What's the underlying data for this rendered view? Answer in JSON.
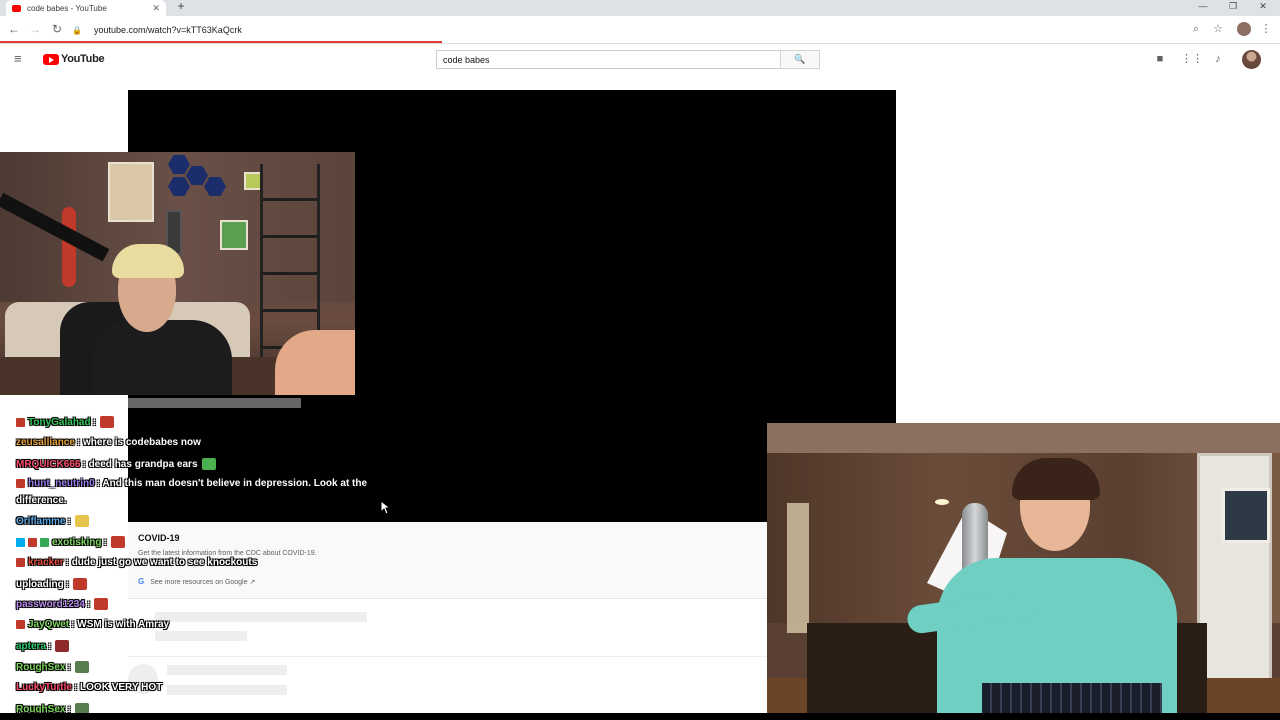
{
  "browser": {
    "tab_title": "code babes - YouTube",
    "tab_close": "✕",
    "new_tab": "+",
    "url": "youtube.com/watch?v=kTT63KaQcrk",
    "window_controls": [
      "—",
      "❐",
      "✕"
    ]
  },
  "youtube": {
    "logo_text": "YouTube",
    "search_value": "code babes",
    "search_button": "🔍"
  },
  "chat": {
    "messages": [
      {
        "user": "TonyGalahad",
        "user_color": "#34c759",
        "message": ":",
        "badges": [
          "red"
        ],
        "emote_color": "#c0392b"
      },
      {
        "user": "zeusalliance",
        "user_color": "#e8a33d",
        "message": ": where is codebabes now",
        "badges": [],
        "emote_color": ""
      },
      {
        "user": "MRQUICK666",
        "user_color": "#ff4d6d",
        "message": ": deed has grandpa ears",
        "badges": [],
        "emote_color": "#4caf50"
      },
      {
        "user": "hunt_neutrin0",
        "user_color": "#9c7df0",
        "message": ": And this man doesn't believe in depression. Look at the",
        "badges": [
          "red"
        ],
        "emote_color": ""
      },
      {
        "user": "",
        "user_color": "#ffffff",
        "message": "difference.",
        "badges": [],
        "emote_color": ""
      },
      {
        "user": "Oriflamme",
        "user_color": "#5aa8e6",
        "message": ":",
        "badges": [],
        "emote_color": "#e6c34a"
      },
      {
        "user": "exotisking",
        "user_color": "#7bd65a",
        "message": ":",
        "badges": [
          "blue",
          "red",
          "green"
        ],
        "emote_color": "#c0392b"
      },
      {
        "user": "kracker",
        "user_color": "#e74c3c",
        "message": ": dude just go we want to see knockouts",
        "badges": [
          "red"
        ],
        "emote_color": ""
      },
      {
        "user": "uploading",
        "user_color": "#ffffff",
        "message": ":",
        "badges": [],
        "emote_color": "#c0392b"
      },
      {
        "user": "password1234",
        "user_color": "#b889f0",
        "message": ":",
        "badges": [],
        "emote_color": "#c0392b"
      },
      {
        "user": "JayQwet",
        "user_color": "#7bd65a",
        "message": ": WSM is with Amray",
        "badges": [
          "red"
        ],
        "emote_color": ""
      },
      {
        "user": "aptera",
        "user_color": "#2ecc71",
        "message": ":",
        "badges": [],
        "emote_color": "#8e2a2a"
      },
      {
        "user": "RoughSex",
        "user_color": "#7bd65a",
        "message": ":",
        "badges": [],
        "emote_color": "#5a7d4e"
      },
      {
        "user": "LuckyTurtle",
        "user_color": "#ff4d6d",
        "message": ": LOOK VERY HOT",
        "badges": [],
        "emote_color": ""
      },
      {
        "user": "RoughSex",
        "user_color": "#7bd65a",
        "message": ":",
        "badges": [],
        "emote_color": "#5a7d4e"
      }
    ]
  },
  "covid_panel": {
    "title": "COVID-19",
    "subtitle": "Get the latest information from the CDC about COVID-19.",
    "link_icon": "G",
    "link_text": "See more resources on Google ↗"
  },
  "icons": [
    "menu-icon",
    "youtube-logo-icon",
    "search-icon",
    "create-video-icon",
    "apps-icon",
    "notifications-icon",
    "avatar",
    "back-icon",
    "forward-icon",
    "reload-icon",
    "lock-icon",
    "zoom-icon",
    "star-icon",
    "more-icon"
  ]
}
